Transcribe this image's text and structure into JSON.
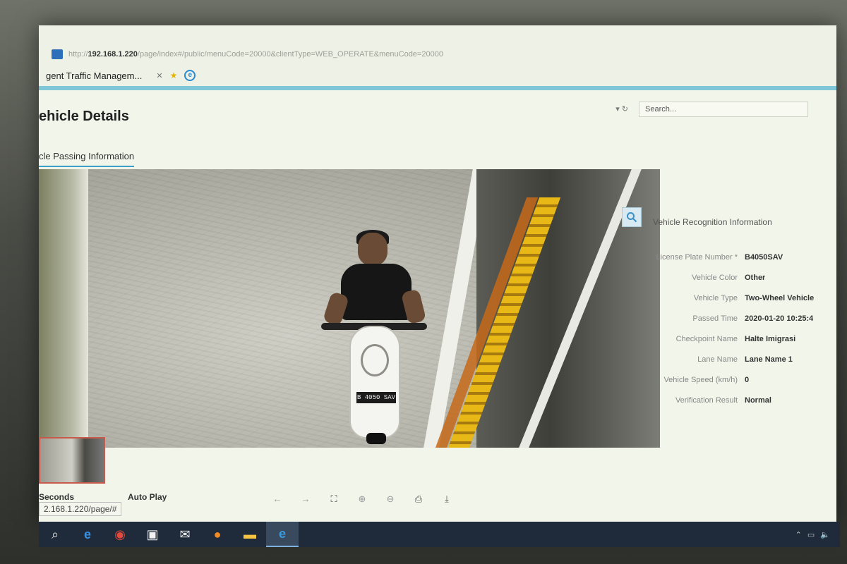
{
  "browser": {
    "url_prefix": "http://",
    "url_host": "192.168.1.220",
    "url_rest": "/page/index#/public/menuCode=20000&clientType=WEB_OPERATE&menuCode=20000",
    "tab_title": "gent Traffic Managem...",
    "search_placeholder": "Search..."
  },
  "page": {
    "title": "ehicle Details",
    "tabs": [
      {
        "label": "cle Passing Information",
        "active": true
      },
      {
        "label": "",
        "active": false
      },
      {
        "label": "",
        "active": false
      }
    ]
  },
  "recognition": {
    "title": "Vehicle Recognition Information",
    "rows": [
      {
        "label": "License Plate Number *",
        "value": "B4050SAV"
      },
      {
        "label": "Vehicle Color",
        "value": "Other"
      },
      {
        "label": "Vehicle Type",
        "value": "Two-Wheel Vehicle"
      },
      {
        "label": "Passed Time",
        "value": "2020-01-20 10:25:4"
      },
      {
        "label": "Checkpoint Name",
        "value": "Halte Imigrasi"
      },
      {
        "label": "Lane Name",
        "value": "Lane Name 1"
      },
      {
        "label": "Vehicle Speed (km/h)",
        "value": "0"
      },
      {
        "label": "Verification Result",
        "value": "Normal"
      }
    ]
  },
  "photo": {
    "plate_text": "B 4050 SAV"
  },
  "playback": {
    "seconds_label": "Seconds",
    "auto_play_label": "Auto Play"
  },
  "status_bar": {
    "url": "2.168.1.220/page/#"
  },
  "taskbar": {
    "icons": [
      "search-icon",
      "edge-icon",
      "chrome-icon",
      "store-icon",
      "mail-icon",
      "firefox-icon",
      "file-explorer-icon",
      "internet-explorer-icon"
    ]
  },
  "colors": {
    "accent": "#7fc6d6",
    "tab_underline": "#3aa0c8",
    "taskbar": "#1f2a3a"
  }
}
